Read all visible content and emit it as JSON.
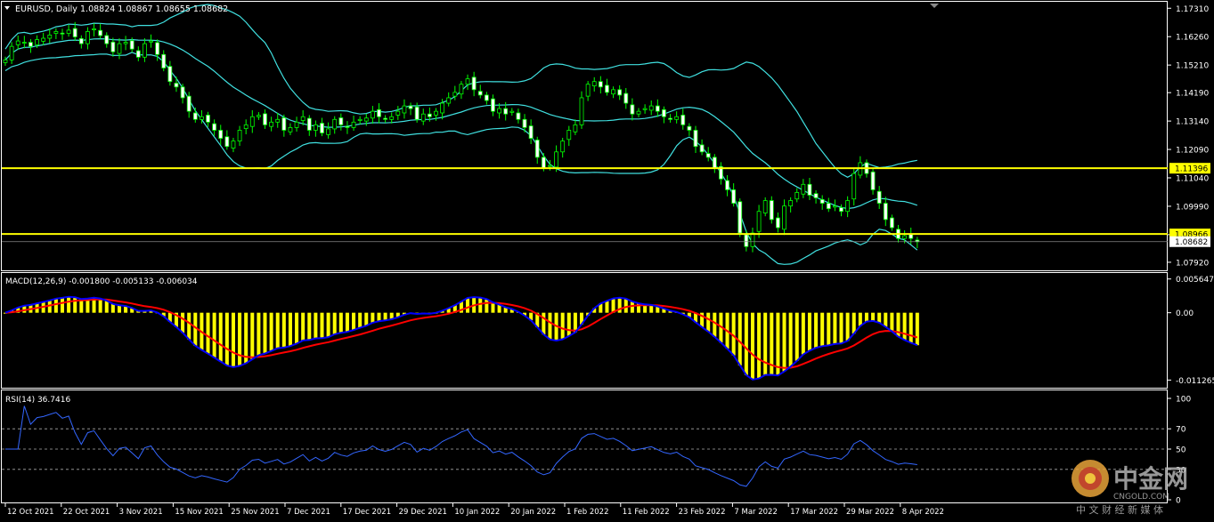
{
  "chart_data": {
    "type": "candlestick",
    "symbol_header": "EURUSD, Daily",
    "ohlc_header": "1.08824 1.08867 1.08655 1.08682",
    "price_axis": {
      "ticks": [
        "1.17310",
        "1.16260",
        "1.15210",
        "1.14190",
        "1.13140",
        "1.12090",
        "1.11040",
        "1.09990",
        "1.08940",
        "1.07920"
      ],
      "ylim": [
        1.0772,
        1.1745
      ]
    },
    "horizontal_lines": [
      {
        "price": 1.11396,
        "label": "1.11396",
        "color": "#ffff00"
      },
      {
        "price": 1.08966,
        "label": "1.08966",
        "color": "#ffff00"
      }
    ],
    "current_price": {
      "price": 1.08682,
      "label": "1.08682"
    },
    "x_axis_dates": [
      "12 Oct 2021",
      "22 Oct 2021",
      "3 Nov 2021",
      "15 Nov 2021",
      "25 Nov 2021",
      "7 Dec 2021",
      "17 Dec 2021",
      "29 Dec 2021",
      "10 Jan 2022",
      "20 Jan 2022",
      "1 Feb 2022",
      "11 Feb 2022",
      "23 Feb 2022",
      "7 Mar 2022",
      "17 Mar 2022",
      "29 Mar 2022",
      "8 Apr 2022"
    ],
    "closes": [
      1.154,
      1.159,
      1.161,
      1.1605,
      1.159,
      1.1615,
      1.162,
      1.1632,
      1.1645,
      1.1638,
      1.165,
      1.1625,
      1.16,
      1.1645,
      1.1655,
      1.163,
      1.16,
      1.157,
      1.16,
      1.1605,
      1.158,
      1.155,
      1.16,
      1.161,
      1.156,
      1.151,
      1.146,
      1.144,
      1.14,
      1.135,
      1.132,
      1.133,
      1.131,
      1.128,
      1.125,
      1.122,
      1.124,
      1.128,
      1.13,
      1.133,
      1.1335,
      1.13,
      1.131,
      1.132,
      1.128,
      1.129,
      1.131,
      1.133,
      1.128,
      1.13,
      1.127,
      1.1285,
      1.132,
      1.13,
      1.129,
      1.131,
      1.132,
      1.1325,
      1.135,
      1.133,
      1.132,
      1.133,
      1.135,
      1.137,
      1.136,
      1.132,
      1.134,
      1.133,
      1.135,
      1.138,
      1.14,
      1.142,
      1.145,
      1.147,
      1.143,
      1.141,
      1.139,
      1.135,
      1.136,
      1.134,
      1.135,
      1.132,
      1.129,
      1.125,
      1.118,
      1.114,
      1.115,
      1.12,
      1.124,
      1.128,
      1.13,
      1.14,
      1.145,
      1.146,
      1.144,
      1.142,
      1.143,
      1.141,
      1.138,
      1.134,
      1.135,
      1.136,
      1.137,
      1.135,
      1.133,
      1.132,
      1.133,
      1.13,
      1.128,
      1.122,
      1.12,
      1.118,
      1.114,
      1.11,
      1.106,
      1.101,
      1.09,
      1.085,
      1.09,
      1.098,
      1.102,
      1.095,
      1.092,
      1.1,
      1.102,
      1.105,
      1.108,
      1.104,
      1.103,
      1.101,
      1.099,
      1.1,
      1.098,
      1.102,
      1.112,
      1.116,
      1.112,
      1.106,
      1.101,
      1.095,
      1.092,
      1.088,
      1.089,
      1.088,
      1.0868
    ],
    "bollinger_bands": {
      "period": 20,
      "color": "#40e0e0"
    },
    "macd": {
      "label": "MACD(12,26,9) -0.001800 -0.005133 -0.006034",
      "ticks": [
        "0.005647",
        "0.00",
        "-0.011265"
      ],
      "ylim": [
        -0.0121,
        0.0062
      ],
      "histogram_color": "#ffff00",
      "main_color": "#0000ff",
      "signal_color": "#ff0000"
    },
    "rsi": {
      "label": "RSI(14) 36.7416",
      "period": 14,
      "ticks": [
        "100",
        "70",
        "50",
        "30",
        "0"
      ],
      "levels": [
        70,
        50,
        30
      ],
      "ylim": [
        0,
        100
      ],
      "color": "#3366ff"
    }
  },
  "watermark": {
    "brand": "中金网",
    "site": "CNGOLD.COM",
    "slogan": "中 文 财 经 新 媒 体"
  }
}
